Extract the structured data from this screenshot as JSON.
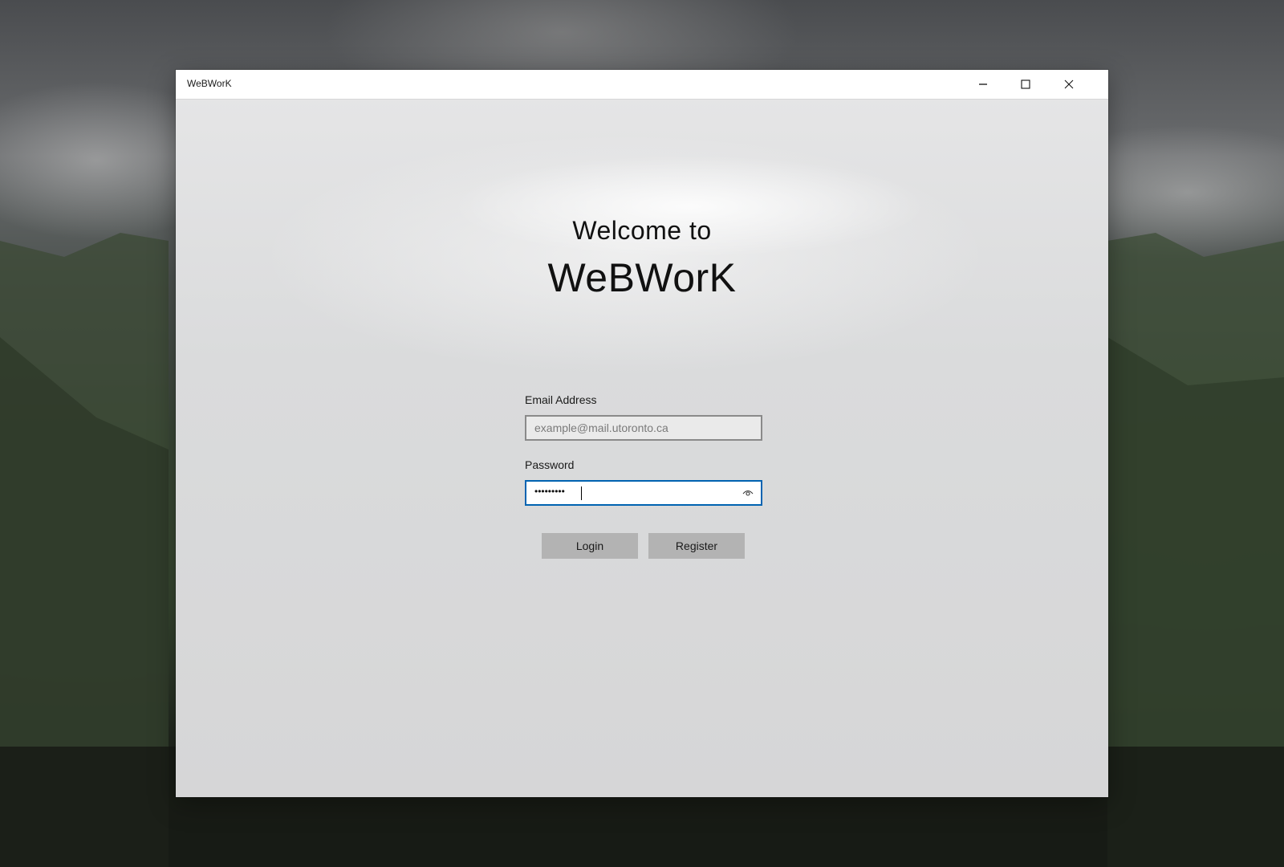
{
  "window": {
    "title": "WeBWorK",
    "controls": {
      "minimize_icon": "minimize-icon",
      "maximize_icon": "maximize-icon",
      "close_icon": "close-icon"
    }
  },
  "welcome": {
    "line1": "Welcome to",
    "line2": "WeBWorK"
  },
  "form": {
    "email": {
      "label": "Email Address",
      "placeholder": "example@mail.utoronto.ca",
      "value": ""
    },
    "password": {
      "label": "Password",
      "masked_value": "•••••••••",
      "reveal_icon": "eye-icon"
    },
    "buttons": {
      "login": "Login",
      "register": "Register"
    }
  },
  "colors": {
    "focus_border": "#0063b1",
    "button_bg": "#b3b3b3"
  }
}
